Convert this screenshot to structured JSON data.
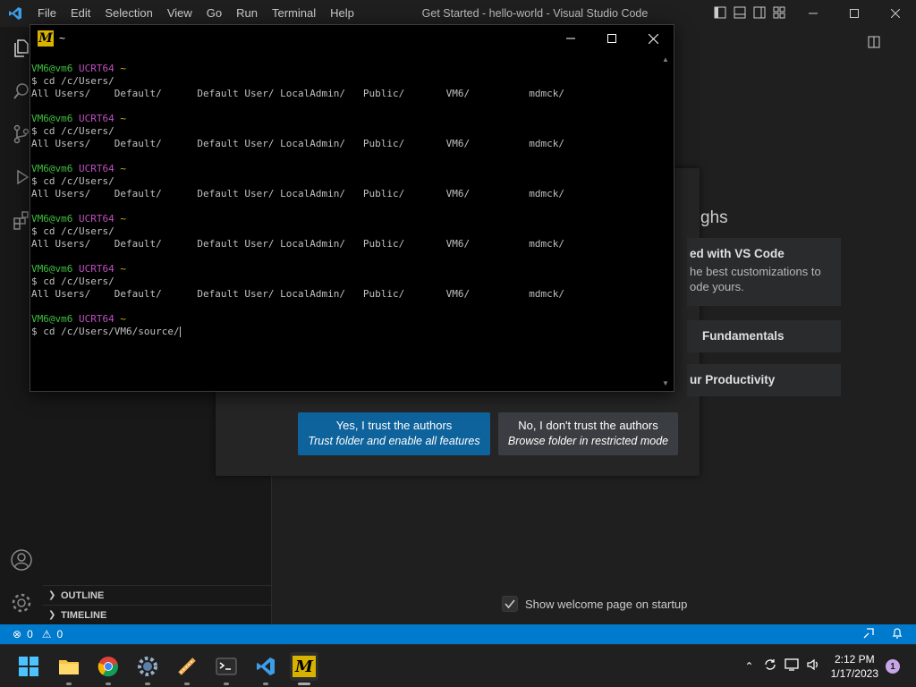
{
  "titlebar": {
    "menu": [
      "File",
      "Edit",
      "Selection",
      "View",
      "Go",
      "Run",
      "Terminal",
      "Help"
    ],
    "window_title": "Get Started - hello-world - Visual Studio Code"
  },
  "sidebar": {
    "sections": [
      "OUTLINE",
      "TIMELINE"
    ]
  },
  "editor": {
    "walkthroughs_heading": "ghs",
    "cards": [
      {
        "title": "ed with VS Code",
        "desc": "he best customizations to\node yours."
      },
      {
        "title": "Fundamentals",
        "desc": ""
      },
      {
        "title": "ur Productivity",
        "desc": ""
      }
    ],
    "welcome_checkbox_label": "Show welcome page on startup",
    "welcome_checked": true
  },
  "dialog": {
    "trust_button": {
      "line1": "Yes, I trust the authors",
      "line2": "Trust folder and enable all features"
    },
    "untrust_button": {
      "line1": "No, I don't trust the authors",
      "line2": "Browse folder in restricted mode"
    }
  },
  "terminal": {
    "title": "~",
    "prompt_user": "VM6@vm6",
    "prompt_env": "UCRT64",
    "prompt_dir": "~",
    "commands": [
      "$ cd /c/Users/",
      "$ cd /c/Users/",
      "$ cd /c/Users/",
      "$ cd /c/Users/",
      "$ cd /c/Users/"
    ],
    "listing": "All Users/    Default/      Default User/ LocalAdmin/   Public/       VM6/          mdmck/",
    "last_command": "$ cd /c/Users/VM6/source/"
  },
  "statusbar": {
    "errors": "0",
    "warnings": "0"
  },
  "taskbar": {
    "apps": [
      "start-icon",
      "file-explorer-icon",
      "chrome-icon",
      "settings-icon",
      "app-icon",
      "terminal-icon",
      "vscode-icon",
      "msys2-icon"
    ],
    "time": "2:12 PM",
    "date": "1/17/2023",
    "notifications": "1"
  },
  "colors": {
    "accent": "#007acc",
    "trust_button": "#0e639c",
    "prompt_green": "#3fbf3f",
    "prompt_magenta": "#c050c0"
  }
}
